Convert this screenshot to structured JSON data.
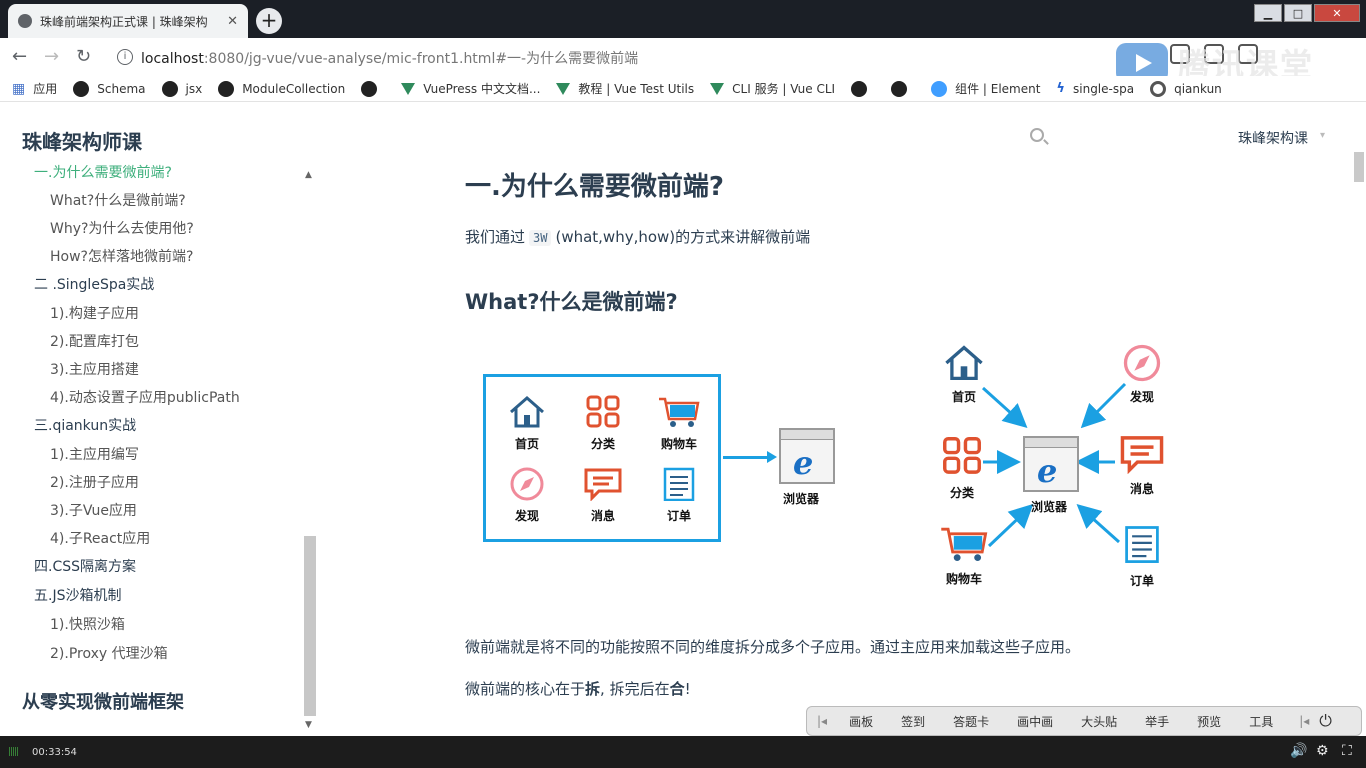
{
  "browser": {
    "tab_title": "珠峰前端架构正式课 | 珠峰架构",
    "tab_close": "✕",
    "new_tab": "+",
    "win_min": "▁",
    "win_max": "□",
    "win_close": "✕",
    "back": "←",
    "forward": "→",
    "reload": "↻",
    "info": "i",
    "url_host": "localhost",
    "url_rest": ":8080/jg-vue/vue-analyse/mic-front1.html#一-为什么需要微前端",
    "watermark": "腾讯课堂"
  },
  "bookmarks": [
    "应用",
    "Schema",
    "jsx",
    "ModuleCollection",
    "VuePress 中文文档...",
    "教程 | Vue Test Utils",
    "CLI 服务 | Vue CLI",
    "组件 | Element",
    "single-spa",
    "qiankun"
  ],
  "header": {
    "site_title": "珠峰架构师课",
    "search_placeholder": "",
    "nav_link": "珠峰架构课",
    "nav_caret": "▾"
  },
  "sidebar": {
    "items": [
      "一.为什么需要微前端?",
      "What?什么是微前端?",
      "Why?为什么去使用他?",
      "How?怎样落地微前端?",
      "二 .SingleSpa实战",
      "1).构建子应用",
      "2).配置库打包",
      "3).主应用搭建",
      "4).动态设置子应用publicPath",
      "三.qiankun实战",
      "1).主应用编写",
      "2).注册子应用",
      "3).子Vue应用",
      "4).子React应用",
      "四.CSS隔离方案",
      "五.JS沙箱机制",
      "1).快照沙箱",
      "2).Proxy 代理沙箱"
    ],
    "group_title": "从零实现微前端框架",
    "arrow_up": "▲",
    "arrow_down": "▼"
  },
  "content": {
    "h1": "一.为什么需要微前端?",
    "p1_before": "我们通过",
    "p1_code": "3W",
    "p1_after": "(what,why,how)的方式来讲解微前端",
    "h2": "What?什么是微前端?",
    "p2": "微前端就是将不同的功能按照不同的维度拆分成多个子应用。通过主应用来加载这些子应用。",
    "p3_before": "微前端的核心在于",
    "p3_bold1": "拆",
    "p3_mid": ", 拆完后在",
    "p3_bold2": "合",
    "p3_after": "!"
  },
  "diagram": {
    "home": "首页",
    "category": "分类",
    "cart": "购物车",
    "discover": "发现",
    "message": "消息",
    "order": "订单",
    "browser": "浏览器"
  },
  "toolstrip": [
    "画板",
    "签到",
    "答题卡",
    "画中画",
    "大头贴",
    "举手",
    "预览",
    "工具"
  ],
  "player": {
    "volume": "|||||",
    "time": "00:33:54"
  }
}
